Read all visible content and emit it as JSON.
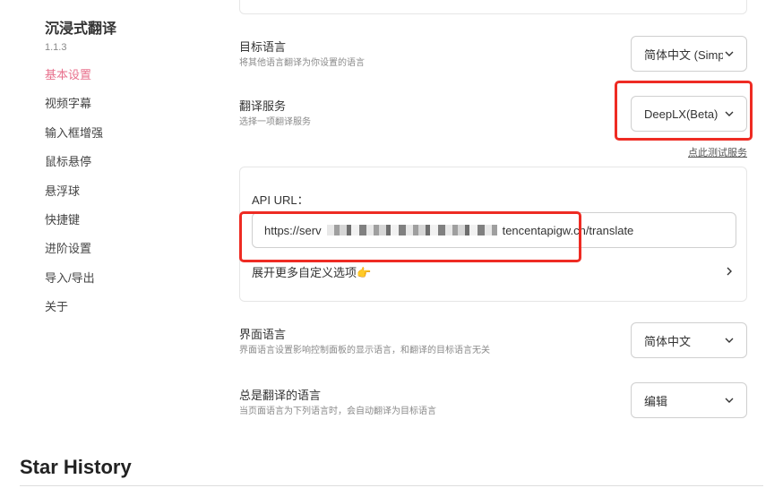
{
  "sidebar": {
    "app_title": "沉浸式翻译",
    "version": "1.1.3",
    "items": [
      {
        "label": "基本设置",
        "active": true
      },
      {
        "label": "视频字幕"
      },
      {
        "label": "输入框增强"
      },
      {
        "label": "鼠标悬停"
      },
      {
        "label": "悬浮球"
      },
      {
        "label": "快捷键"
      },
      {
        "label": "进阶设置"
      },
      {
        "label": "导入/导出"
      },
      {
        "label": "关于"
      }
    ]
  },
  "settings": {
    "target_language": {
      "label": "目标语言",
      "desc": "将其他语言翻译为你设置的语言",
      "value": "简体中文 (Simplified Chinese)"
    },
    "translation_service": {
      "label": "翻译服务",
      "desc": "选择一项翻译服务",
      "value": "DeepLX(Beta)",
      "test_link": "点此测试服务"
    },
    "api": {
      "label": "API URL：",
      "value_prefix": "https://serv",
      "value_suffix": "tencentapigw.cn/translate",
      "expand_label": "展开更多自定义选项👉"
    },
    "ui_language": {
      "label": "界面语言",
      "desc": "界面语言设置影响控制面板的显示语言，和翻译的目标语言无关",
      "value": "简体中文"
    },
    "always_translate": {
      "label": "总是翻译的语言",
      "desc": "当页面语言为下列语言时，会自动翻译为目标语言",
      "value": "编辑"
    }
  },
  "star_history": {
    "title": "Star History"
  },
  "colors": {
    "accent": "#e8718d",
    "highlight": "#ee2b23",
    "border": "#cfcfcf"
  },
  "icons": {
    "dropdown": "chevron-down-icon",
    "expand": "chevron-right-icon"
  }
}
